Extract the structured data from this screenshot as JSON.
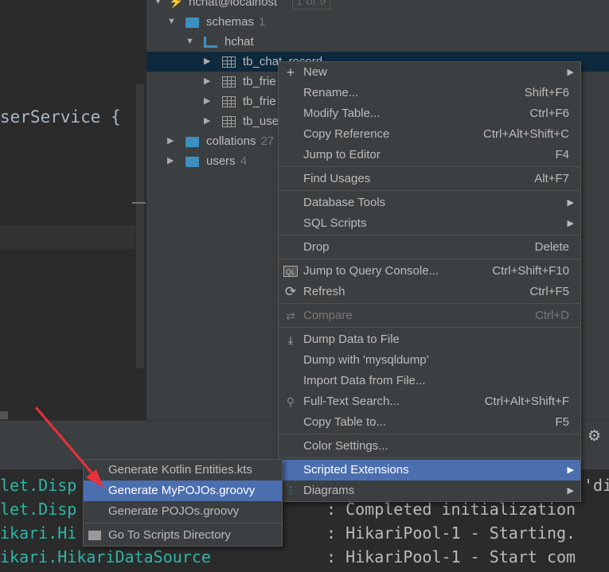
{
  "editor": {
    "code_line": "serService {"
  },
  "tree": {
    "connection": {
      "label": "hchat@localhost",
      "badge": "1 of 9"
    },
    "schemas": {
      "label": "schemas",
      "count": "1"
    },
    "schema": {
      "label": "hchat"
    },
    "tables": [
      "tb_chat_record",
      "tb_frie",
      "tb_frie",
      "tb_use"
    ],
    "collations": {
      "label": "collations",
      "count": "27"
    },
    "users": {
      "label": "users",
      "count": "4"
    }
  },
  "context_menu": {
    "items": [
      {
        "label": "New",
        "icon": "plus-icon",
        "submenu": true
      },
      {
        "label": "Rename...",
        "shortcut": "Shift+F6"
      },
      {
        "label": "Modify Table...",
        "shortcut": "Ctrl+F6"
      },
      {
        "label": "Copy Reference",
        "shortcut": "Ctrl+Alt+Shift+C"
      },
      {
        "label": "Jump to Editor",
        "shortcut": "F4"
      },
      {
        "label": "Find Usages",
        "shortcut": "Alt+F7"
      },
      {
        "label": "Database Tools",
        "submenu": true
      },
      {
        "label": "SQL Scripts",
        "submenu": true
      },
      {
        "label": "Drop",
        "shortcut": "Delete"
      },
      {
        "label": "Jump to Query Console...",
        "shortcut": "Ctrl+Shift+F10",
        "icon": "query-console-icon"
      },
      {
        "label": "Refresh",
        "shortcut": "Ctrl+F5",
        "icon": "refresh-icon"
      },
      {
        "label": "Compare",
        "shortcut": "Ctrl+D",
        "icon": "compare-icon",
        "disabled": true
      },
      {
        "label": "Dump Data to File",
        "icon": "download-icon"
      },
      {
        "label": "Dump with 'mysqldump'"
      },
      {
        "label": "Import Data from File..."
      },
      {
        "label": "Full-Text Search...",
        "shortcut": "Ctrl+Alt+Shift+F",
        "icon": "search-icon"
      },
      {
        "label": "Copy Table to...",
        "shortcut": "F5"
      },
      {
        "label": "Color Settings..."
      },
      {
        "label": "Scripted Extensions",
        "submenu": true,
        "highlighted": true
      },
      {
        "label": "Diagrams",
        "submenu": true,
        "icon": "diagram-icon"
      }
    ]
  },
  "submenu": {
    "items": [
      {
        "label": "Generate Kotlin Entities.kts"
      },
      {
        "label": "Generate MyPOJOs.groovy",
        "highlighted": true
      },
      {
        "label": "Generate POJOs.groovy"
      },
      {
        "label": "Go To Scripts Directory",
        "icon": "folder-icon"
      }
    ]
  },
  "console": {
    "lines": [
      {
        "logger": "let.Disp",
        "message": "'di"
      },
      {
        "logger": "let.Disp",
        "message": ": Completed initialization"
      },
      {
        "logger": "ikari.Hi",
        "message": ": HikariPool-1 - Starting."
      },
      {
        "logger": "ikari.HikariDataSource",
        "message": ": HikariPool-1 - Start com"
      }
    ]
  },
  "colors": {
    "highlight": "#4b6eaf",
    "selection": "#0d293e",
    "arrow": "#e8303a",
    "logger": "#2fb5a6"
  }
}
